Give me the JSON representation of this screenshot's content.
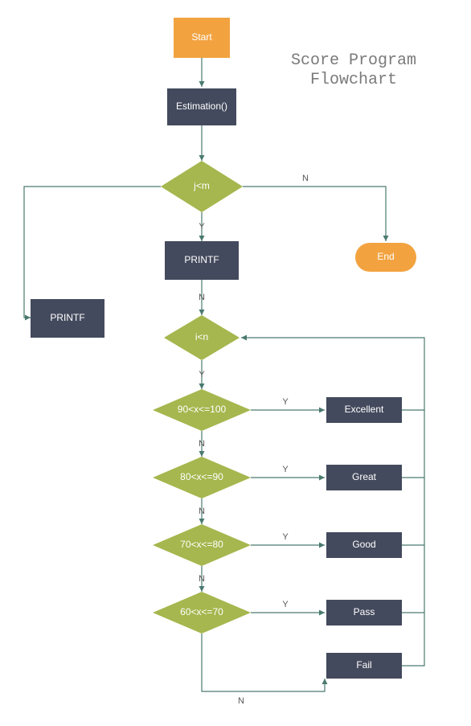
{
  "title_line1": "Score Program",
  "title_line2": "Flowchart",
  "nodes": {
    "start": "Start",
    "estimation": "Estimation()",
    "jm": "j<m",
    "printf1": "PRINTF",
    "printf2": "PRINTF",
    "in": "i<n",
    "cond1": "90<x<=100",
    "cond2": "80<x<=90",
    "cond3": "70<x<=80",
    "cond4": "60<x<=70",
    "excellent": "Excellent",
    "great": "Great",
    "good": "Good",
    "pass": "Pass",
    "fail": "Fail",
    "end": "End"
  },
  "labels": {
    "Y": "Y",
    "N": "N"
  },
  "colors": {
    "startEnd": "#f2a340",
    "process": "#444a5d",
    "decision": "#a5b74e",
    "edge": "#4a7a6f"
  },
  "chart_data": {
    "type": "flowchart",
    "title": "Score Program Flowchart",
    "nodes": [
      {
        "id": "start",
        "type": "terminator",
        "label": "Start"
      },
      {
        "id": "estimation",
        "type": "process",
        "label": "Estimation()"
      },
      {
        "id": "jm",
        "type": "decision",
        "label": "j<m"
      },
      {
        "id": "printf1",
        "type": "process",
        "label": "PRINTF"
      },
      {
        "id": "printf2",
        "type": "process",
        "label": "PRINTF"
      },
      {
        "id": "in",
        "type": "decision",
        "label": "i<n"
      },
      {
        "id": "cond1",
        "type": "decision",
        "label": "90<x<=100"
      },
      {
        "id": "cond2",
        "type": "decision",
        "label": "80<x<=90"
      },
      {
        "id": "cond3",
        "type": "decision",
        "label": "70<x<=80"
      },
      {
        "id": "cond4",
        "type": "decision",
        "label": "60<x<=70"
      },
      {
        "id": "excellent",
        "type": "process",
        "label": "Excellent"
      },
      {
        "id": "great",
        "type": "process",
        "label": "Great"
      },
      {
        "id": "good",
        "type": "process",
        "label": "Good"
      },
      {
        "id": "pass",
        "type": "process",
        "label": "Pass"
      },
      {
        "id": "fail",
        "type": "process",
        "label": "Fail"
      },
      {
        "id": "end",
        "type": "terminator",
        "label": "End"
      }
    ],
    "edges": [
      {
        "from": "start",
        "to": "estimation"
      },
      {
        "from": "estimation",
        "to": "jm"
      },
      {
        "from": "jm",
        "to": "printf1",
        "label": "Y"
      },
      {
        "from": "jm",
        "to": "end",
        "label": "N"
      },
      {
        "from": "jm",
        "to": "printf2",
        "label": ""
      },
      {
        "from": "printf1",
        "to": "in",
        "label": "N"
      },
      {
        "from": "in",
        "to": "cond1",
        "label": "Y"
      },
      {
        "from": "cond1",
        "to": "excellent",
        "label": "Y"
      },
      {
        "from": "cond1",
        "to": "cond2",
        "label": "N"
      },
      {
        "from": "cond2",
        "to": "great",
        "label": "Y"
      },
      {
        "from": "cond2",
        "to": "cond3",
        "label": "N"
      },
      {
        "from": "cond3",
        "to": "good",
        "label": "Y"
      },
      {
        "from": "cond3",
        "to": "cond4",
        "label": "N"
      },
      {
        "from": "cond4",
        "to": "pass",
        "label": "Y"
      },
      {
        "from": "cond4",
        "to": "fail",
        "label": "N"
      },
      {
        "from": "excellent",
        "to": "in"
      },
      {
        "from": "great",
        "to": "in"
      },
      {
        "from": "good",
        "to": "in"
      },
      {
        "from": "pass",
        "to": "in"
      },
      {
        "from": "fail",
        "to": "in"
      }
    ]
  }
}
